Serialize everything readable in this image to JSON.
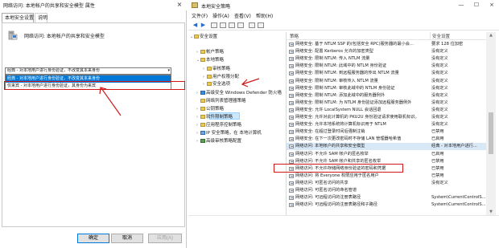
{
  "dialog": {
    "title": "网络访问: 本地帐户的共享和安全模型 属性",
    "close_glyph": "×",
    "tabs": [
      "本地安全设置",
      "说明"
    ],
    "policy_name": "网络访问: 本地帐户的共享和安全模型",
    "select_value": "经典 - 对本地用户进行身份验证，不改变其本来身份",
    "options": [
      "经典 - 对本地用户进行身份验证，不改变其本来身份",
      "仅来宾 - 对本地用户进行身份验证，其身份为来宾"
    ],
    "buttons": {
      "ok": "确定",
      "cancel": "取消",
      "apply": "应用(A)"
    },
    "annotation_color": "#d01818"
  },
  "window": {
    "title": "本地安全策略",
    "controls": {
      "minimize": "—",
      "maximize": "☐",
      "close": "×"
    },
    "menu": [
      "文件(F)",
      "操作(A)",
      "查看(V)",
      "帮助(H)"
    ],
    "tree": [
      {
        "label": "安全设置",
        "expanded": true,
        "icon": "folder"
      },
      {
        "label": "帐户策略",
        "expanded": false,
        "icon": "folder"
      },
      {
        "label": "本地策略",
        "expanded": true,
        "icon": "folder"
      },
      {
        "label": "审核策略",
        "expanded": false,
        "icon": "folder"
      },
      {
        "label": "用户权限分配",
        "expanded": false,
        "icon": "folder"
      },
      {
        "label": "安全选项",
        "expanded": false,
        "icon": "folder",
        "selected": true
      },
      {
        "label": "高级安全 Windows Defender 防火墙",
        "expanded": false,
        "icon": "shield"
      },
      {
        "label": "网络列表管理器策略",
        "expanded": false,
        "icon": "folder"
      },
      {
        "label": "公钥策略",
        "expanded": false,
        "icon": "folder"
      },
      {
        "label": "软件限制策略",
        "expanded": false,
        "icon": "folder"
      },
      {
        "label": "应用程序控制策略",
        "expanded": false,
        "icon": "folder"
      },
      {
        "label": "IP 安全策略，在 本地计算机",
        "expanded": false,
        "icon": "net"
      },
      {
        "label": "高级审核策略配置",
        "expanded": false,
        "icon": "bar"
      }
    ],
    "list_headers": {
      "policy": "策略",
      "setting": "安全设置"
    },
    "rows": [
      {
        "policy": "网络安全: 基于 NTLM SSP 的(包括安全 RPC)服务器的最小会...",
        "setting": "要求 128 位加密"
      },
      {
        "policy": "网络安全: 配置 Kerberos 允许的加密类型",
        "setting": "没有定义"
      },
      {
        "policy": "网络安全: 限制 NTLM: 传入 NTLM 流量",
        "setting": "没有定义"
      },
      {
        "policy": "网络安全: 限制 NTLM: 此域中的 NTLM 身份验证",
        "setting": "没有定义"
      },
      {
        "policy": "网络安全: 限制 NTLM: 到远程服务器的传出 NTLM 流量",
        "setting": "没有定义"
      },
      {
        "policy": "网络安全: 限制 NTLM: 审核传入 NTLM 流量",
        "setting": "没有定义"
      },
      {
        "policy": "网络安全: 限制 NTLM: 审核此域中的 NTLM 身份验证",
        "setting": "没有定义"
      },
      {
        "policy": "网络安全: 限制 NTLM: 添加此域中的服务器例外",
        "setting": "没有定义"
      },
      {
        "policy": "网络安全: 限制 NTLM: 为 NTLM 身份验证添加远程服务器例外",
        "setting": "没有定义"
      },
      {
        "policy": "网络安全: 允许 LocalSystem NULL 会话回退",
        "setting": "没有定义"
      },
      {
        "policy": "网络安全: 允许对此计算机的 PKU2U 身份验证请求使用联机标识。",
        "setting": "没有定义"
      },
      {
        "policy": "网络安全: 允许本地系统将计算机标识用于 NTLM",
        "setting": "没有定义"
      },
      {
        "policy": "网络安全: 在超过登录时间后强制注销",
        "setting": "已禁用"
      },
      {
        "policy": "网络安全: 在下一次更改密码时不存储 LAN 管理器哈希值",
        "setting": "已启用"
      },
      {
        "policy": "网络访问: 本地帐户的共享和安全模型",
        "setting": "经典 - 对本地用户进行...",
        "selected": true
      },
      {
        "policy": "网络访问: 不允许 SAM 帐户的匿名枚举",
        "setting": "已启用"
      },
      {
        "policy": "网络访问: 不允许 SAM 帐户和共享的匿名枚举",
        "setting": "已禁用"
      },
      {
        "policy": "网络访问: 不允许存储网络身份验证的密码和凭据",
        "setting": "已禁用"
      },
      {
        "policy": "网络访问: 将 Everyone 权限应用于匿名用户",
        "setting": "已禁用"
      },
      {
        "policy": "网络访问: 可匿名访问的共享",
        "setting": "没有定义"
      },
      {
        "policy": "网络访问: 可匿名访问的命名管道",
        "setting": ""
      },
      {
        "policy": "网络访问: 可远程访问的注册表路径",
        "setting": "System\\CurrentControlS..."
      },
      {
        "policy": "网络访问: 可远程访问的注册表路径和子路径",
        "setting": "System\\CurrentControlS..."
      }
    ],
    "scroll_up_glyph": "▲",
    "scroll_down_glyph": "▼",
    "selection_color": "#cce8ff",
    "annotation_color": "#d01818"
  }
}
